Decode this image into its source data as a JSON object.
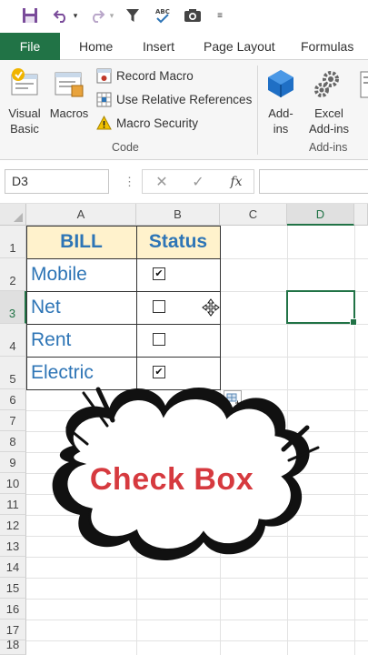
{
  "ribbon": {
    "tabs": [
      "File",
      "Home",
      "Insert",
      "Page Layout",
      "Formulas"
    ],
    "code_group": {
      "visual_basic_label": "Visual Basic",
      "macros_label": "Macros",
      "record_macro": "Record Macro",
      "use_relative_references": "Use Relative References",
      "macro_security": "Macro Security",
      "group_label": "Code"
    },
    "addins_group": {
      "addins_label": "Add- ins",
      "excel_addins_label": "Excel Add-ins",
      "group_label": "Add-ins"
    }
  },
  "formula_bar": {
    "name_box": "D3",
    "cancel_symbol": "✕",
    "enter_symbol": "✓",
    "fx_symbol": "fx",
    "value": ""
  },
  "sheet": {
    "columns": [
      "A",
      "B",
      "C",
      "D"
    ],
    "selected_column": "D",
    "rows": [
      "1",
      "2",
      "3",
      "4",
      "5",
      "6",
      "7",
      "8",
      "9",
      "10",
      "11",
      "12",
      "13",
      "14",
      "15",
      "16",
      "17",
      "18"
    ],
    "selected_row": "3",
    "active_cell": "D3",
    "table": {
      "header_bill": "BILL",
      "header_status": "Status",
      "rows": [
        {
          "bill": "Mobile",
          "checked": true
        },
        {
          "bill": "Net",
          "checked": false
        },
        {
          "bill": "Rent",
          "checked": false
        },
        {
          "bill": "Electric",
          "checked": true
        }
      ]
    },
    "check_mark": "✔"
  },
  "overlay": {
    "caption": "Check Box"
  },
  "colors": {
    "excel_green": "#217346",
    "header_fill": "#fff2cc",
    "text_blue": "#2e75b6",
    "caption_red": "#d63a3f"
  }
}
